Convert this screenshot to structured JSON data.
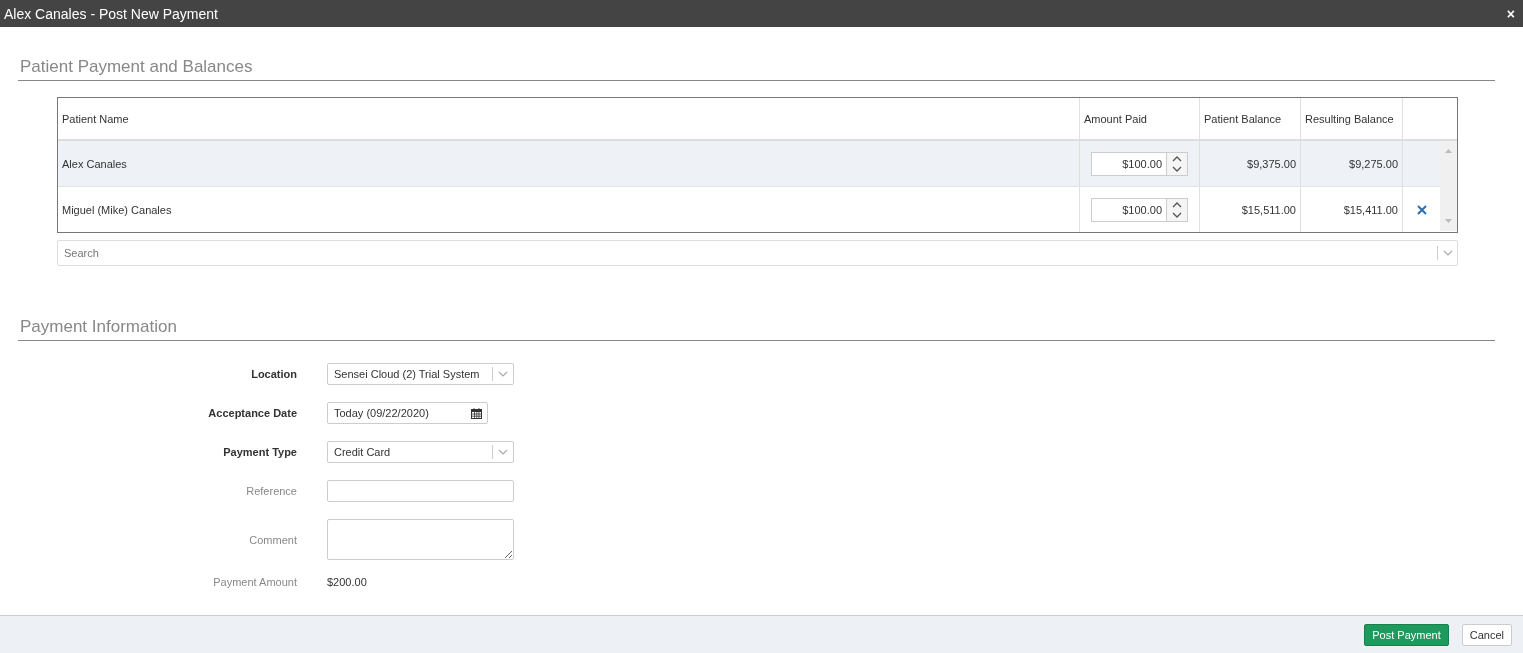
{
  "window": {
    "title": "Alex Canales - Post New Payment",
    "close": "×"
  },
  "balances": {
    "heading": "Patient Payment and Balances",
    "columns": [
      "Patient Name",
      "Amount Paid",
      "Patient Balance",
      "Resulting Balance"
    ],
    "rows": [
      {
        "name": "Alex Canales",
        "amount": "$100.00",
        "patient_balance": "$9,375.00",
        "resulting_balance": "$9,275.00",
        "selected": true,
        "removable": false
      },
      {
        "name": "Miguel (Mike) Canales",
        "amount": "$100.00",
        "patient_balance": "$15,511.00",
        "resulting_balance": "$15,411.00",
        "selected": false,
        "removable": true
      }
    ],
    "search": {
      "placeholder": "Search"
    }
  },
  "payment": {
    "heading": "Payment Information",
    "fields": [
      {
        "label": "Location",
        "required": true,
        "kind": "select",
        "value": "Sensei Cloud (2) Trial System"
      },
      {
        "label": "Acceptance Date",
        "required": true,
        "kind": "date",
        "value": "Today (09/22/2020)"
      },
      {
        "label": "Payment Type",
        "required": true,
        "kind": "select",
        "value": "Credit Card"
      },
      {
        "label": "Reference",
        "required": false,
        "kind": "text"
      },
      {
        "label": "Comment",
        "required": false,
        "kind": "textarea"
      },
      {
        "label": "Payment Amount",
        "required": false,
        "kind": "static",
        "value": "$200.00"
      }
    ]
  },
  "buttons": [
    {
      "label": "Post Payment",
      "kind": "primary"
    },
    {
      "label": "Cancel",
      "kind": "secondary"
    }
  ]
}
